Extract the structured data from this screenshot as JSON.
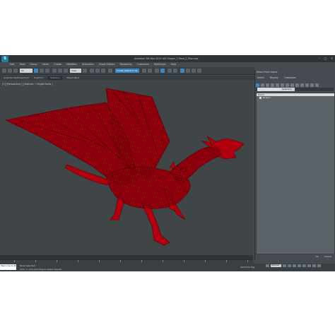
{
  "app": {
    "title": "Autodesk 3ds Max 2015 x64    Dragon_2 Rhea_2_Max.max",
    "logo": "3ds-max-logo"
  },
  "menu": [
    "Edit",
    "Tools",
    "Group",
    "Views",
    "Create",
    "Modifiers",
    "Animation",
    "Graph Editors",
    "Rendering",
    "Customize",
    "MAXScript",
    "Help"
  ],
  "toolbar": {
    "filter_dropdown": "All",
    "view_dropdown": "View",
    "selection_set": "Create Selection Se"
  },
  "ribbon": {
    "tabs": [
      "Graphite Modeling Tools",
      "Freeform",
      "Selection",
      "Object Paint"
    ],
    "active_index": 2
  },
  "viewport": {
    "label": "[+] [Perspective ] [ Realistic + Edged Faces ]"
  },
  "scene_explorer": {
    "title": "Select From Scene",
    "menu": [
      "Select",
      "Display",
      "Customize"
    ],
    "search_placeholder": "",
    "selection_set": "Selection Set:",
    "column_header": "Name",
    "rows": [
      "Dragon"
    ],
    "ok_label": "OK",
    "cancel_label": "Cancel"
  },
  "status": {
    "maxscript_label": "Welcome to M",
    "selection": "None Selected",
    "message": "Click or click-and-drag to select objects",
    "add_time_tag": "Add Time Tag",
    "key_mode": "Selected"
  },
  "colors": {
    "accent": "#3d86c6",
    "dragon": "#b00010",
    "viewport_bg": "#404548"
  }
}
